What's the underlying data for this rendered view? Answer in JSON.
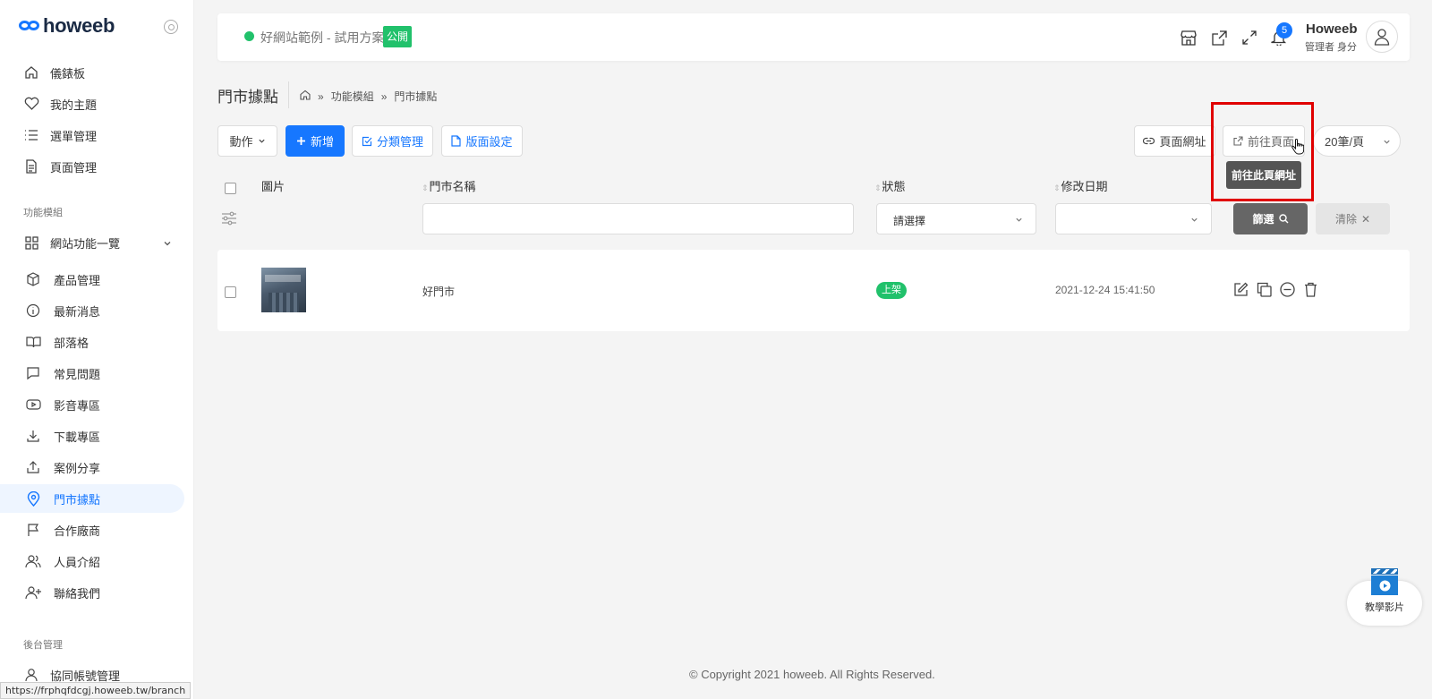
{
  "brand": {
    "logo_text": "howeeb",
    "accent": "#1677ff",
    "success": "#21c16b"
  },
  "sidebar": {
    "main_items": [
      {
        "label": "儀錶板",
        "icon": "home-icon"
      },
      {
        "label": "我的主題",
        "icon": "heart-icon"
      },
      {
        "label": "選單管理",
        "icon": "list-icon"
      },
      {
        "label": "頁面管理",
        "icon": "document-icon"
      }
    ],
    "section_modules": "功能模組",
    "group_label": "網站功能一覽",
    "module_items": [
      {
        "label": "產品管理",
        "icon": "box-icon"
      },
      {
        "label": "最新消息",
        "icon": "info-icon"
      },
      {
        "label": "部落格",
        "icon": "book-icon"
      },
      {
        "label": "常見問題",
        "icon": "chat-icon"
      },
      {
        "label": "影音專區",
        "icon": "video-icon"
      },
      {
        "label": "下載專區",
        "icon": "download-icon"
      },
      {
        "label": "案例分享",
        "icon": "share-icon"
      },
      {
        "label": "門市據點",
        "icon": "map-pin-icon",
        "active": true
      },
      {
        "label": "合作廠商",
        "icon": "flag-icon"
      },
      {
        "label": "人員介紹",
        "icon": "users-icon"
      },
      {
        "label": "聯絡我們",
        "icon": "user-plus-icon"
      }
    ],
    "section_backend": "後台管理",
    "backend_items": [
      {
        "label": "協同帳號管理",
        "icon": "user-icon"
      }
    ]
  },
  "status_bar_url": "https://frphqfdcgj.howeeb.tw/branch",
  "header": {
    "site_name": "好網站範例 - 試用方案",
    "public_badge": "公開",
    "notifications": "5",
    "user_name": "Howeeb",
    "user_role": "管理者 身分"
  },
  "page": {
    "title": "門市據點",
    "breadcrumb": [
      "功能模組",
      "門市據點"
    ]
  },
  "toolbar": {
    "action": "動作",
    "add": "新增",
    "category": "分類管理",
    "layout": "版面設定",
    "page_url": "頁面網址",
    "goto_page": "前往頁面",
    "per_page": "20筆/頁",
    "tooltip": "前往此頁網址"
  },
  "table": {
    "columns": {
      "image": "圖片",
      "name": "門市名稱",
      "status": "狀態",
      "modified": "修改日期"
    },
    "status_placeholder": "請選擇",
    "filter_btn": "篩選",
    "clear_btn": "清除",
    "rows": [
      {
        "name": "好門市",
        "status": "上架",
        "modified": "2021-12-24 15:41:50"
      }
    ]
  },
  "footer": "© Copyright 2021 howeeb. All Rights Reserved.",
  "tutorial": "教學影片"
}
